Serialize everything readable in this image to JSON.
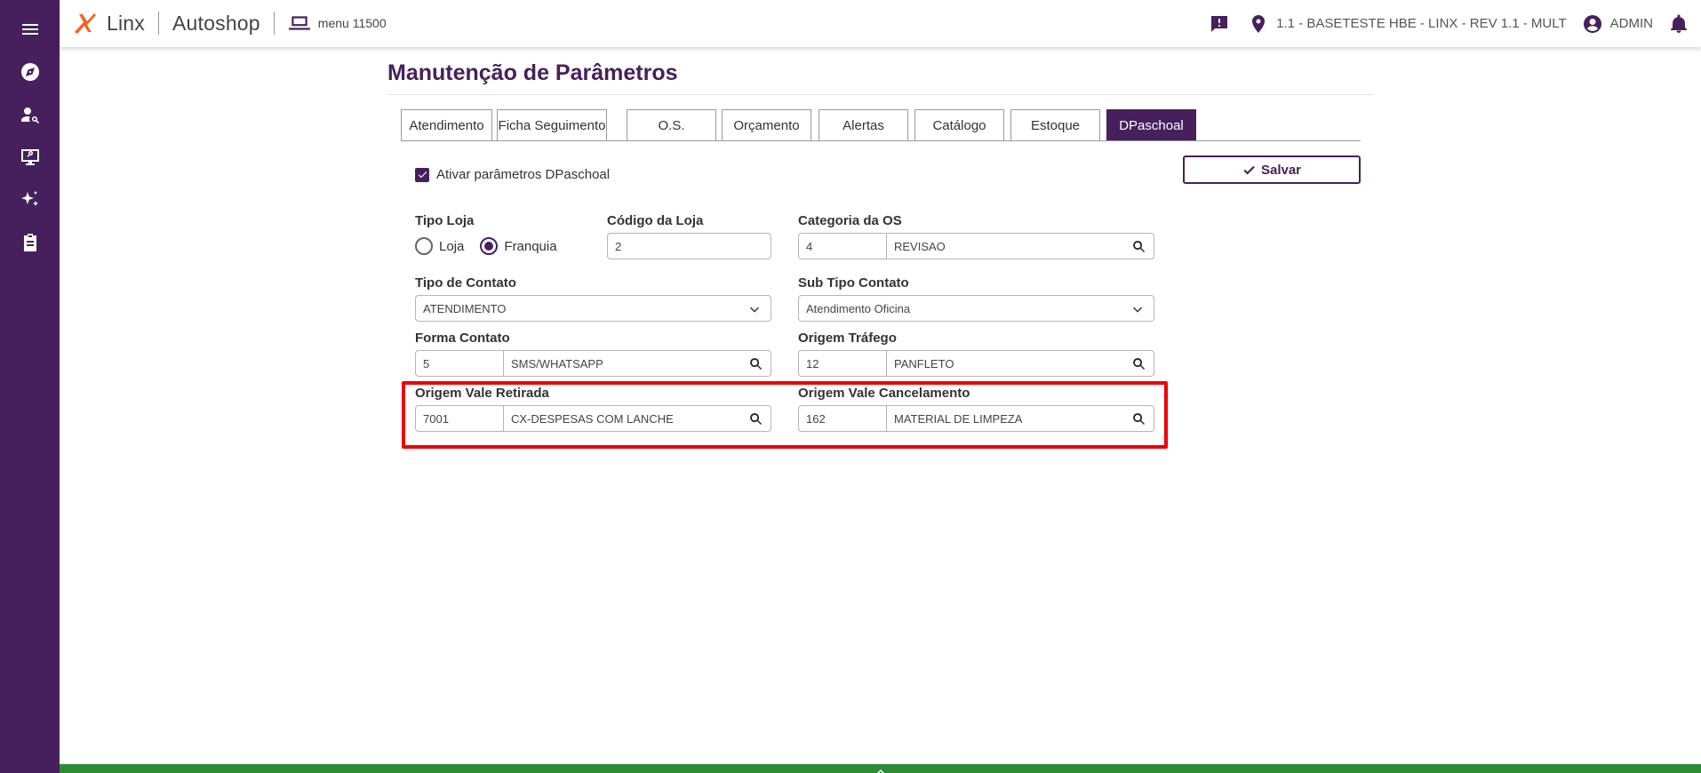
{
  "header": {
    "brand_name": "Linx",
    "app_name": "Autoshop",
    "menu_code": "menu 11500",
    "location": "1.1 - BASETESTE HBE - LINX - REV 1.1 - MULT",
    "user": "ADMIN",
    "icons": [
      "chat-alert-icon",
      "location-pin-icon",
      "account-circle-icon",
      "bell-icon"
    ]
  },
  "sidebar": {
    "icons": [
      "hamburger-menu-icon",
      "compass-icon",
      "user-search-icon",
      "monitor-icon",
      "sparkles-icon",
      "clipboard-icon"
    ]
  },
  "page": {
    "title": "Manutenção de Parâmetros"
  },
  "tabs": [
    {
      "label": "Atendimento",
      "active": false
    },
    {
      "label": "Ficha Seguimento",
      "active": false
    },
    {
      "label": "O.S.",
      "active": false
    },
    {
      "label": "Orçamento",
      "active": false
    },
    {
      "label": "Alertas",
      "active": false
    },
    {
      "label": "Catálogo",
      "active": false
    },
    {
      "label": "Estoque",
      "active": false
    },
    {
      "label": "DPaschoal",
      "active": true
    }
  ],
  "form": {
    "activate_label": "Ativar parâmetros DPaschoal",
    "activate_checked": true,
    "save_label": "Salvar",
    "tipo_loja": {
      "label": "Tipo Loja",
      "options": [
        {
          "label": "Loja",
          "selected": false
        },
        {
          "label": "Franquia",
          "selected": true
        }
      ]
    },
    "codigo_loja": {
      "label": "Código da Loja",
      "value": "2"
    },
    "categoria_os": {
      "label": "Categoria da OS",
      "code": "4",
      "description": "REVISAO"
    },
    "tipo_contato": {
      "label": "Tipo de Contato",
      "value": "ATENDIMENTO"
    },
    "sub_tipo_contato": {
      "label": "Sub Tipo Contato",
      "value": "Atendimento Oficina"
    },
    "forma_contato": {
      "label": "Forma Contato",
      "code": "5",
      "description": "SMS/WHATSAPP"
    },
    "origem_trafego": {
      "label": "Origem Tráfego",
      "code": "12",
      "description": "PANFLETO"
    },
    "origem_vale_retirada": {
      "label": "Origem Vale Retirada",
      "code": "7001",
      "description": "CX-DESPESAS COM LANCHE"
    },
    "origem_vale_cancelamento": {
      "label": "Origem Vale Cancelamento",
      "code": "162",
      "description": "MATERIAL DE LIMPEZA"
    }
  },
  "colors": {
    "primary": "#46205c",
    "highlight": "#ee0000",
    "footer": "#2e8b35",
    "logo": "#f26522"
  }
}
